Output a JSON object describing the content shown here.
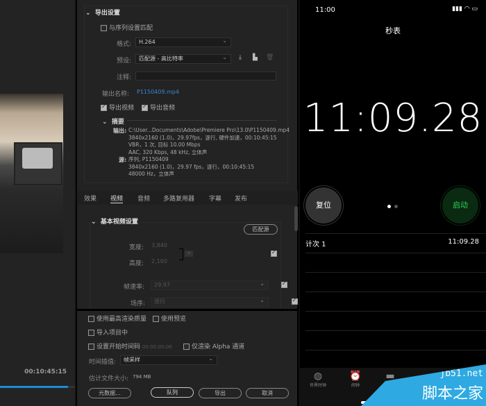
{
  "left_panel": {
    "timecode": "00:10:45:15",
    "progress": 0.98
  },
  "export": {
    "section_title": "导出设置",
    "match_sequence": "与序列设置匹配",
    "format_label": "格式:",
    "format_value": "H.264",
    "preset_label": "预设:",
    "preset_value": "匹配源 - 高比特率",
    "comment_label": "注释:",
    "comment_value": "",
    "output_name_label": "输出名称:",
    "output_name": "P1150409.mp4",
    "export_video": "导出视频",
    "export_audio": "导出音频",
    "summary_title": "摘要",
    "output_label": "输出:",
    "output_lines": [
      "C:\\User...Documents\\Adobe\\Premiere Pro\\13.0\\P1150409.mp4",
      "3840x2160 (1.0)，29.97fps，逐行, 硬件加速，00:10:45:15",
      "VBR，1 次, 目标 10.00 Mbps",
      "AAC, 320 Kbps, 48 kHz, 立体声"
    ],
    "source_label": "源:",
    "source_lines": [
      "序列, P1150409",
      "3840x2160 (1.0)，29.97 fps，逐行，00:10:45:15",
      "48000 Hz，立体声"
    ]
  },
  "tabs": [
    "效果",
    "视频",
    "音频",
    "多路复用器",
    "字幕",
    "发布"
  ],
  "active_tab": 1,
  "video": {
    "section_title": "基本视频设置",
    "match_source": "匹配源",
    "width_label": "宽度:",
    "width": "3,840",
    "height_label": "高度:",
    "height": "2,160",
    "fps_label": "帧速率:",
    "fps": "29.97",
    "order_label": "场序:",
    "order": "逐行"
  },
  "bottom": {
    "max_quality": "使用最高渲染质量",
    "use_preview": "使用预览",
    "import_project": "导入项目中",
    "start_tc": "设置开始时间码",
    "start_tc_value": "00:00:00:00",
    "alpha_only": "仅渲染 Alpha 通道",
    "interp_label": "时间插值:",
    "interp_value": "帧采样",
    "filesize_label": "估计文件大小:",
    "filesize": "794 MB",
    "metadata": "元数据...",
    "queue": "队列",
    "export": "导出",
    "cancel": "取消"
  },
  "phone": {
    "clock": "11:00",
    "title": "秒表",
    "time": "11:09.28",
    "reset": "复位",
    "start": "启动",
    "laps": [
      {
        "label": "计次 1",
        "time": "11:09.28"
      }
    ],
    "tabbar": [
      "世界时钟",
      "闹钟",
      "就寝"
    ],
    "colors": {
      "start": "#30d158",
      "start_bg": "#0a2a12"
    }
  },
  "watermark": {
    "site": "jb51.net",
    "name": "脚本之家"
  }
}
